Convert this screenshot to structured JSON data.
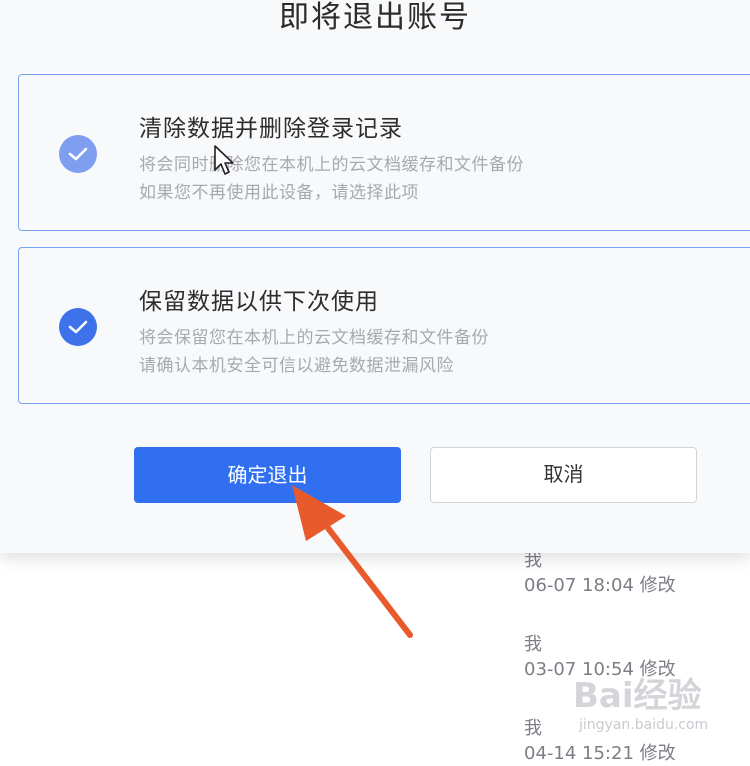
{
  "dialog": {
    "title": "即将退出账号",
    "options": [
      {
        "title": "清除数据并删除登录记录",
        "desc_line1": "将会同时删除您在本机上的云文档缓存和文件备份",
        "desc_line2": "如果您不再使用此设备，请选择此项"
      },
      {
        "title": "保留数据以供下次使用",
        "desc_line1": "将会保留您在本机上的云文档缓存和文件备份",
        "desc_line2": "请确认本机安全可信以避免数据泄漏风险"
      }
    ],
    "confirm_label": "确定退出",
    "cancel_label": "取消"
  },
  "file_list": [
    {
      "owner": "我",
      "modified": "06-07 18:04 修改"
    },
    {
      "owner": "我",
      "modified": "03-07 10:54 修改"
    },
    {
      "owner": "我",
      "modified": "04-14 15:21 修改"
    }
  ],
  "watermark": {
    "logo": "Bai经验",
    "url": "jingyan.baidu.com"
  },
  "colors": {
    "accent": "#2f6ff0",
    "check_light": "#7f9ef0",
    "annotation_arrow": "#e85a2c"
  }
}
